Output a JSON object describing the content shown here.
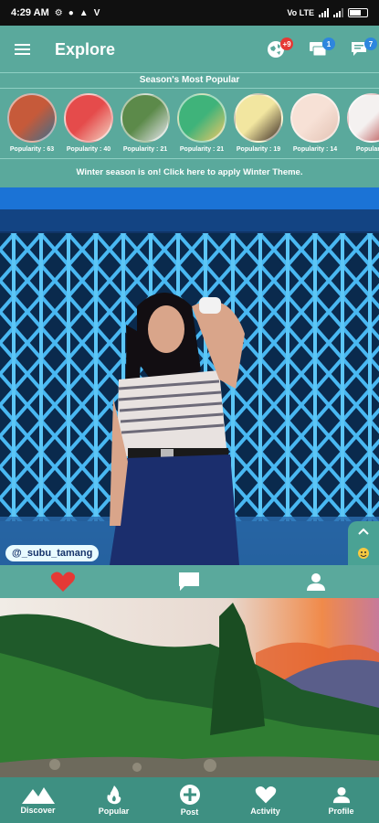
{
  "status_bar": {
    "time": "4:29 AM",
    "left_glyphs": [
      "⚙",
      "●",
      "▲",
      "V"
    ],
    "right_text": "Vo LTE",
    "battery_level": 0.65
  },
  "header": {
    "title": "Explore",
    "badges": {
      "notifications": "+9",
      "messages": "1",
      "chat": "7"
    }
  },
  "popular": {
    "title": "Season's Most Popular",
    "items": [
      {
        "label": "Popularity : 63",
        "colors": [
          "#c65a3a",
          "#3d6e8c"
        ]
      },
      {
        "label": "Popularity : 40",
        "colors": [
          "#e54b4b",
          "#f3d3c2"
        ]
      },
      {
        "label": "Popularity : 21",
        "colors": [
          "#5c8a4a",
          "#e8e8f0"
        ]
      },
      {
        "label": "Popularity : 21",
        "colors": [
          "#3fb37a",
          "#f0c864"
        ]
      },
      {
        "label": "Popularity : 19",
        "colors": [
          "#f2e6a0",
          "#3a2a24"
        ]
      },
      {
        "label": "Popularity : 14",
        "colors": [
          "#f7e1d6",
          "#e3c2b4"
        ]
      },
      {
        "label": "Popularity",
        "colors": [
          "#f4f1f0",
          "#b23a3a"
        ]
      }
    ]
  },
  "promo": {
    "text": "Winter season is on! Click here to apply Winter Theme."
  },
  "post": {
    "username": "@_subu_tamang"
  },
  "bottom_nav": [
    {
      "label": "Discover",
      "icon": "mountain-icon"
    },
    {
      "label": "Popular",
      "icon": "flame-icon"
    },
    {
      "label": "Post",
      "icon": "plus-circle-icon"
    },
    {
      "label": "Activity",
      "icon": "heart-icon"
    },
    {
      "label": "Profile",
      "icon": "person-icon"
    }
  ],
  "colors": {
    "primary": "#5aa99c",
    "nav": "#3e9082",
    "like": "#e53935"
  }
}
